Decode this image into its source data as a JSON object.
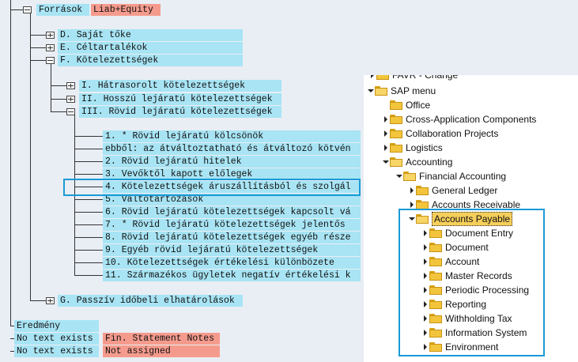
{
  "tree": {
    "root_label": "Források",
    "root_tag": "Liab+Equity",
    "nodes": {
      "d": "D. Saját tőke",
      "e": "E. Céltartalékok",
      "f": "F. Kötelezettségek",
      "f1": "I. Hátrasorolt kötelezettségek",
      "f2": "II. Hosszú lejáratú kötelezettségek",
      "f3": "III. Rövid lejáratú kötelezettségek",
      "g": "G. Passzív időbeli elhatárolások"
    },
    "items": [
      "1. *  Rövid lejáratú kölcsönök",
      "ebből: az átváltoztatható és átváltozó kötvén",
      "2. Rövid lejáratú hitelek",
      "3. Vevőktől kapott előlegek",
      "4. Kötelezettségek áruszállításból és szolgál",
      "5. Váltótartozások",
      "6. Rövid lejáratú kötelezettségek kapcsolt vá",
      "7. *  Rövid lejáratú kötelezettségek jelentős",
      "8. Rövid lejáratú kötelezettségek egyéb része",
      "9. Egyéb rövid lejáratú kötelezettségek",
      "10. Kötelezettségek értékelési különbözete",
      "11. Származékos ügyletek negatív értékelési k"
    ],
    "bottom": [
      {
        "label": "Eredmény",
        "tag": ""
      },
      {
        "label": "No text exists",
        "tag": "Fin. Statement Notes"
      },
      {
        "label": "No text exists",
        "tag": "Not assigned"
      }
    ]
  },
  "sap_menu": {
    "top_partial": "FAVR - Change",
    "rows": [
      {
        "label": "SAP menu",
        "level": 0,
        "arrow": "down",
        "open": true
      },
      {
        "label": "Office",
        "level": 1,
        "arrow": "none",
        "open": false
      },
      {
        "label": "Cross-Application Components",
        "level": 1,
        "arrow": "right",
        "open": false
      },
      {
        "label": "Collaboration Projects",
        "level": 1,
        "arrow": "right",
        "open": false
      },
      {
        "label": "Logistics",
        "level": 1,
        "arrow": "right",
        "open": false
      },
      {
        "label": "Accounting",
        "level": 1,
        "arrow": "down",
        "open": true
      },
      {
        "label": "Financial Accounting",
        "level": 2,
        "arrow": "down",
        "open": true
      },
      {
        "label": "General Ledger",
        "level": 3,
        "arrow": "right",
        "open": false
      },
      {
        "label": "Accounts Receivable",
        "level": 3,
        "arrow": "right",
        "open": false
      },
      {
        "label": "Accounts Payable",
        "level": 3,
        "arrow": "down",
        "open": true,
        "selected": true
      },
      {
        "label": "Document Entry",
        "level": 4,
        "arrow": "right",
        "open": false
      },
      {
        "label": "Document",
        "level": 4,
        "arrow": "right",
        "open": false
      },
      {
        "label": "Account",
        "level": 4,
        "arrow": "right",
        "open": false
      },
      {
        "label": "Master Records",
        "level": 4,
        "arrow": "right",
        "open": false
      },
      {
        "label": "Periodic Processing",
        "level": 4,
        "arrow": "right",
        "open": false
      },
      {
        "label": "Reporting",
        "level": 4,
        "arrow": "right",
        "open": false
      },
      {
        "label": "Withholding Tax",
        "level": 4,
        "arrow": "right",
        "open": false
      },
      {
        "label": "Information System",
        "level": 4,
        "arrow": "right",
        "open": false
      },
      {
        "label": "Environment",
        "level": 4,
        "arrow": "right",
        "open": false
      }
    ]
  },
  "colors": {
    "label_bg": "#a8e4f4",
    "tag_bg": "#f59b8d",
    "highlight_border": "#1a9ad6",
    "folder": "#f2c53c"
  }
}
